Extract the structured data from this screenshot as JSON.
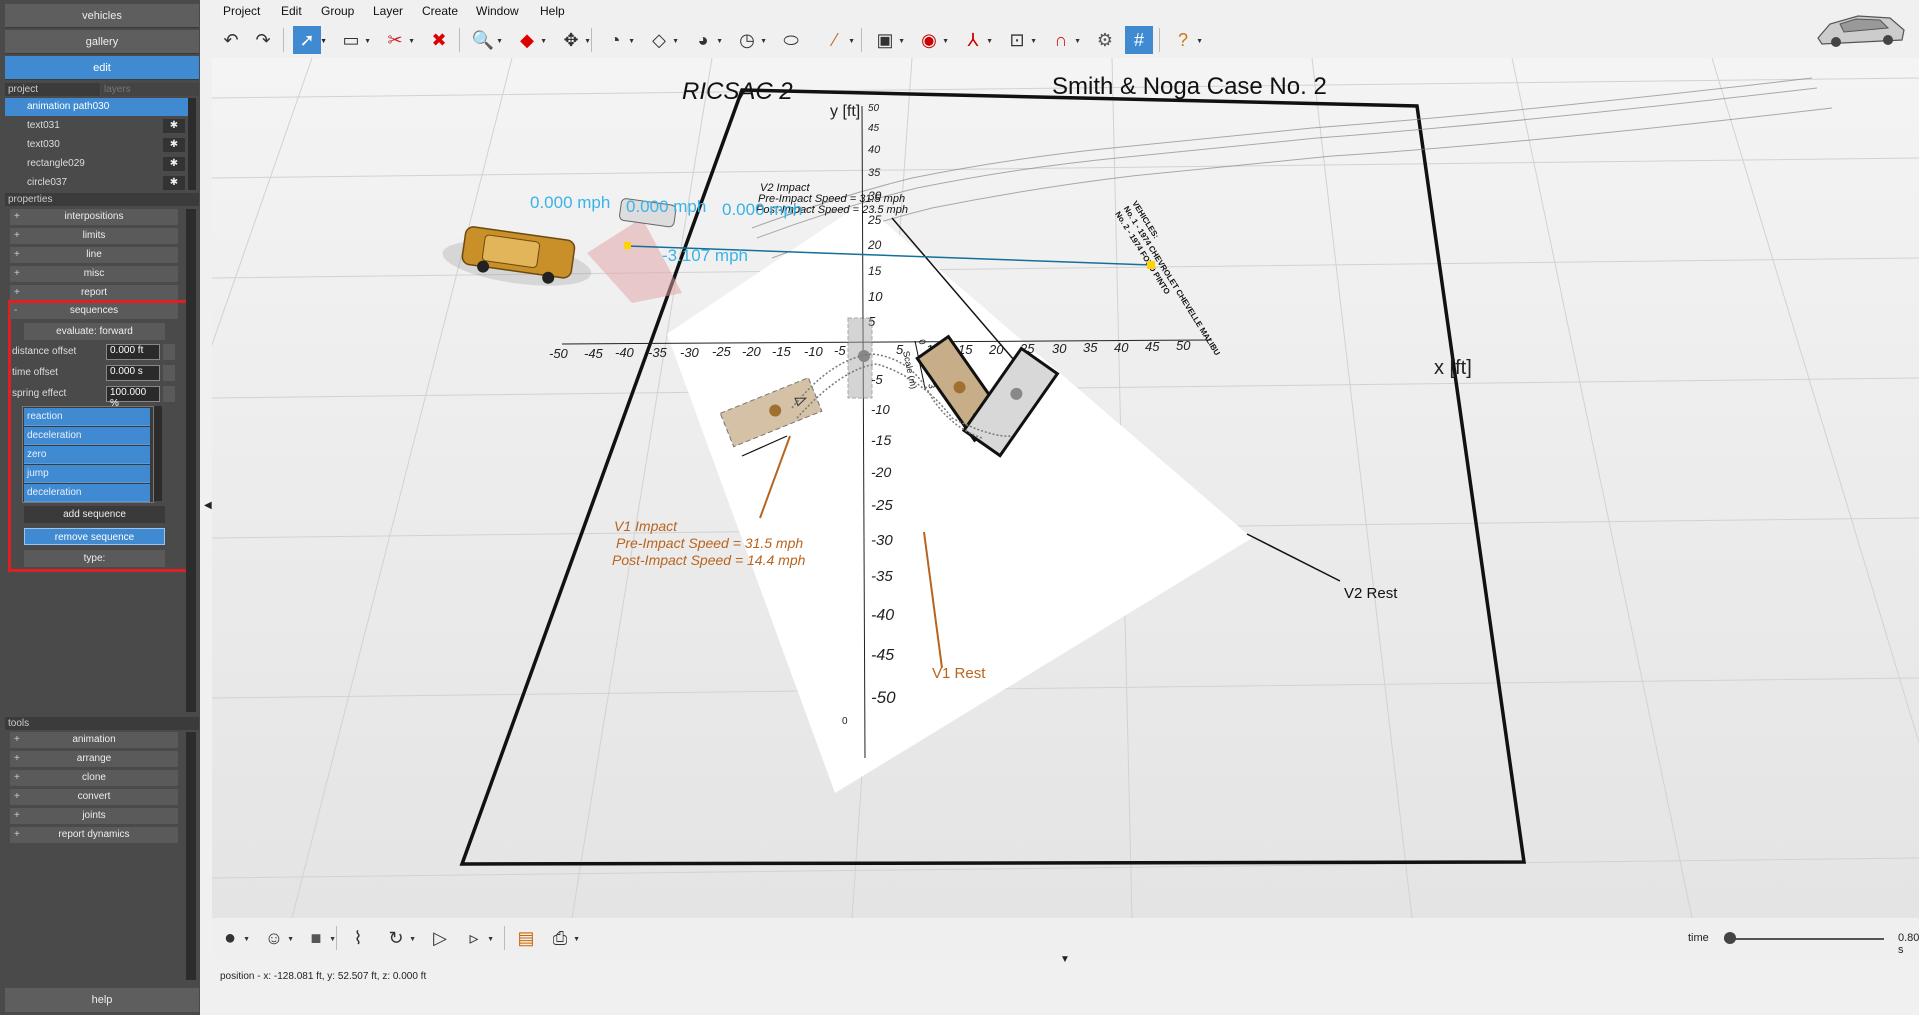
{
  "sidebar": {
    "nav": [
      "vehicles",
      "gallery",
      "edit"
    ],
    "project_tabs": [
      "project",
      "layers"
    ],
    "layers": [
      {
        "label": "animation path030",
        "selected": true
      },
      {
        "label": "text031"
      },
      {
        "label": "text030"
      },
      {
        "label": "rectangle029"
      },
      {
        "label": "circle037"
      }
    ],
    "properties_head": "properties",
    "properties": [
      "interpositions",
      "limits",
      "line",
      "misc",
      "report"
    ],
    "sequences": {
      "label": "sequences",
      "evaluate": "evaluate: forward",
      "fields": [
        {
          "label": "distance offset",
          "value": "0.000 ft"
        },
        {
          "label": "time offset",
          "value": "0.000 s"
        },
        {
          "label": "spring effect",
          "value": "100.000 %"
        }
      ],
      "items": [
        "reaction",
        "deceleration",
        "zero",
        "jump",
        "deceleration"
      ],
      "add": "add sequence",
      "remove": "remove sequence",
      "type": "type:"
    },
    "tools_head": "tools",
    "tools": [
      "animation",
      "arrange",
      "clone",
      "convert",
      "joints",
      "report dynamics"
    ],
    "help": "help"
  },
  "menu": [
    "Project",
    "Edit",
    "Group",
    "Layer",
    "Create",
    "Window",
    "Help"
  ],
  "scene": {
    "title_left": "RICSAC 2",
    "title_right": "Smith & Noga Case No. 2",
    "y_axis_label": "y [ft]",
    "x_axis_label": "x [ft]",
    "x_ticks": [
      "-50",
      "-45",
      "-40",
      "-35",
      "-30",
      "-25",
      "-20",
      "-15",
      "-10",
      "-5",
      "5",
      "10",
      "15",
      "20",
      "25",
      "30",
      "35",
      "40",
      "45",
      "50"
    ],
    "y_ticks": [
      "50",
      "45",
      "40",
      "35",
      "30",
      "25",
      "20",
      "15",
      "10",
      "5",
      "-5",
      "-10",
      "-15",
      "-20",
      "-25",
      "-30",
      "-35",
      "-40",
      "-45",
      "-50"
    ],
    "v2_impact": [
      "V2 Impact",
      "Pre-Impact Speed = 31.5 mph",
      "Post-Impact Speed = 23.5 mph"
    ],
    "v1_impact": [
      "V1 Impact",
      "Pre-Impact Speed = 31.5 mph",
      "Post-Impact Speed = 14.4 mph"
    ],
    "v1_rest": "V1 Rest",
    "v2_rest": "V2 Rest",
    "vehicles_note": [
      "VEHICLES:",
      "No. 1 - 1974 CHEVROLET CHEVELLE MALIBU",
      "No. 2 - 1974 FORD PINTO"
    ],
    "scale_label": "Scale (m)",
    "scale_ticks": [
      "0",
      "1",
      "2",
      "3"
    ],
    "speed_labels": [
      "0.000 mph",
      "0.000 mph",
      "0.000 mph",
      "-3.107 mph"
    ],
    "zero_mark": "0"
  },
  "bottom": {
    "time_label": "time",
    "time_value": "0.800 s",
    "time_fraction": 0.04
  },
  "status": "position - x: -128.081 ft, y: 52.507 ft, z: 0.000 ft"
}
